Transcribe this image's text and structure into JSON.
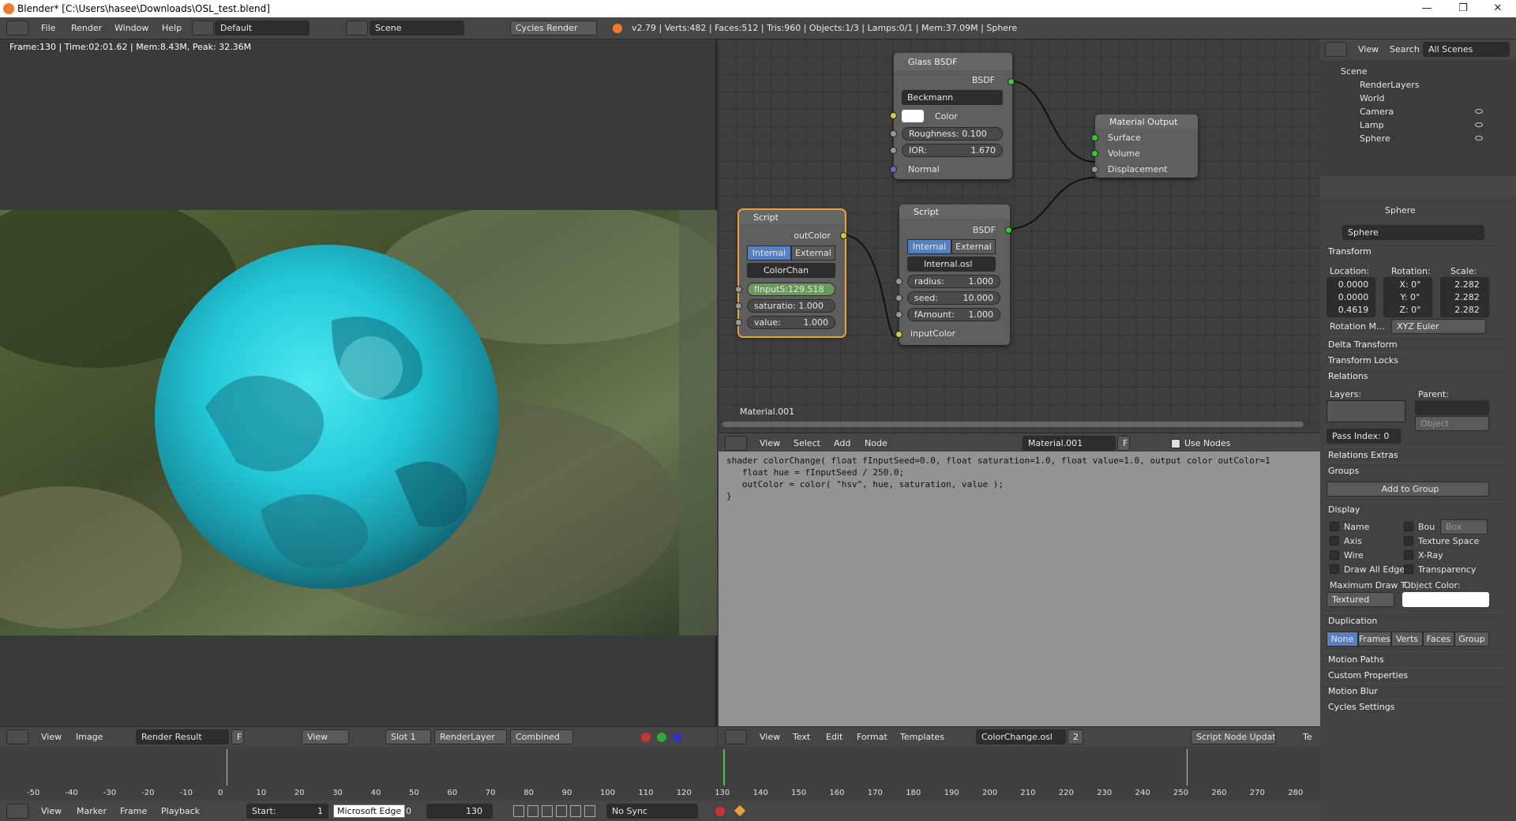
{
  "window": {
    "title": "Blender* [C:\\Users\\hasee\\Downloads\\OSL_test.blend]",
    "min": "—",
    "max": "❐",
    "close": "✕"
  },
  "info": {
    "menus": [
      "File",
      "Render",
      "Window",
      "Help"
    ],
    "layout": "Default",
    "scene": "Scene",
    "engine": "Cycles Render",
    "stats": "v2.79 | Verts:482 | Faces:512 | Tris:960 | Objects:1/3 | Lamps:0/1 | Mem:37.09M | Sphere"
  },
  "viewport": {
    "stats": "Frame:130 | Time:02:01.62 | Mem:8.43M, Peak: 32.36M",
    "footer": {
      "view": "View",
      "image": "Image",
      "render_result": "Render Result",
      "f": "F",
      "view2": "View",
      "slot": "Slot 1",
      "layer": "RenderLayer",
      "pass": "Combined"
    }
  },
  "nodes": {
    "glass": {
      "title": "Glass BSDF",
      "out": "BSDF",
      "dist": "Beckmann",
      "color": "Color",
      "rough_label": "Roughness:",
      "rough": "0.100",
      "ior_label": "IOR:",
      "ior": "1.670",
      "normal": "Normal"
    },
    "output": {
      "title": "Material Output",
      "surface": "Surface",
      "volume": "Volume",
      "disp": "Displacement"
    },
    "script1": {
      "title": "Script",
      "out": "outColor",
      "internal": "Internal",
      "external": "External",
      "file": "ColorChan",
      "in1": "fInputS:129.518",
      "in2_label": "saturatio:",
      "in2": "1.000",
      "in3_label": "value:",
      "in3": "1.000"
    },
    "script2": {
      "title": "Script",
      "out": "BSDF",
      "internal": "Internal",
      "external": "External",
      "file": "Internal.osl",
      "r_label": "radius:",
      "r": "1.000",
      "s_label": "seed:",
      "s": "10.000",
      "a_label": "fAmount:",
      "a": "1.000",
      "input": "inputColor"
    },
    "material_label": "Material.001"
  },
  "node_header": {
    "view": "View",
    "select": "Select",
    "add": "Add",
    "node": "Node",
    "material": "Material.001",
    "f": "F",
    "use_nodes": "Use Nodes"
  },
  "code": "shader colorChange( float fInputSeed=0.0, float saturation=1.0, float value=1.0, output color outColor=1\n   float hue = fInputSeed / 250.0;\n   outColor = color( \"hsv\", hue, saturation, value );\n}",
  "text_header": {
    "view": "View",
    "text": "Text",
    "edit": "Edit",
    "format": "Format",
    "templates": "Templates",
    "file": "ColorChange.osl",
    "users": "2",
    "update": "Script Node Update",
    "extra": "Te"
  },
  "outliner": {
    "view": "View",
    "search": "Search",
    "scope": "All Scenes",
    "items": [
      "Scene",
      "RenderLayers",
      "World",
      "Camera",
      "Lamp",
      "Sphere"
    ]
  },
  "props": {
    "crumb": "Sphere",
    "name": "Sphere",
    "transform": "Transform",
    "loc": "Location:",
    "rot": "Rotation:",
    "scale": "Scale:",
    "lx": "0.0000",
    "ly": "0.0000",
    "lz": "0.4619",
    "rx": "X:  0°",
    "ry": "Y:  0°",
    "rz": "Z:  0°",
    "sx": "2.282",
    "sy": "2.282",
    "sz": "2.282",
    "rotmode_label": "Rotation M...",
    "rotmode": "XYZ Euler",
    "delta": "Delta Transform",
    "locks": "Transform Locks",
    "relations": "Relations",
    "layers": "Layers:",
    "parent": "Parent:",
    "object": "Object",
    "pass_index": "Pass Index:",
    "pass_val": "0",
    "rel_extras": "Relations Extras",
    "groups": "Groups",
    "add_group": "Add to Group",
    "display": "Display",
    "d_name": "Name",
    "d_bou": "Bou",
    "d_box": "Box",
    "d_axis": "Axis",
    "d_tex": "Texture Space",
    "d_wire": "Wire",
    "d_xray": "X-Ray",
    "d_edges": "Draw All Edges",
    "d_transp": "Transparency",
    "max_draw": "Maximum Draw T...",
    "obj_color": "Object Color:",
    "textured": "Textured",
    "duplication": "Duplication",
    "dup": [
      "None",
      "Frames",
      "Verts",
      "Faces",
      "Group"
    ],
    "motion_paths": "Motion Paths",
    "custom": "Custom Properties",
    "motion_blur": "Motion Blur",
    "cycles": "Cycles Settings"
  },
  "timeline": {
    "ticks": [
      "-50",
      "-40",
      "-30",
      "-20",
      "-10",
      "0",
      "10",
      "20",
      "30",
      "40",
      "50",
      "60",
      "70",
      "80",
      "90",
      "100",
      "110",
      "120",
      "130",
      "140",
      "150",
      "160",
      "170",
      "180",
      "190",
      "200",
      "210",
      "220",
      "230",
      "240",
      "250",
      "260",
      "270",
      "280"
    ]
  },
  "playback": {
    "view": "View",
    "marker": "Marker",
    "frame": "Frame",
    "playback": "Playback",
    "start": "Start:",
    "start_val": "1",
    "end_val": "0",
    "current": "130",
    "sync": "No Sync",
    "tooltip": "Microsoft Edge"
  }
}
